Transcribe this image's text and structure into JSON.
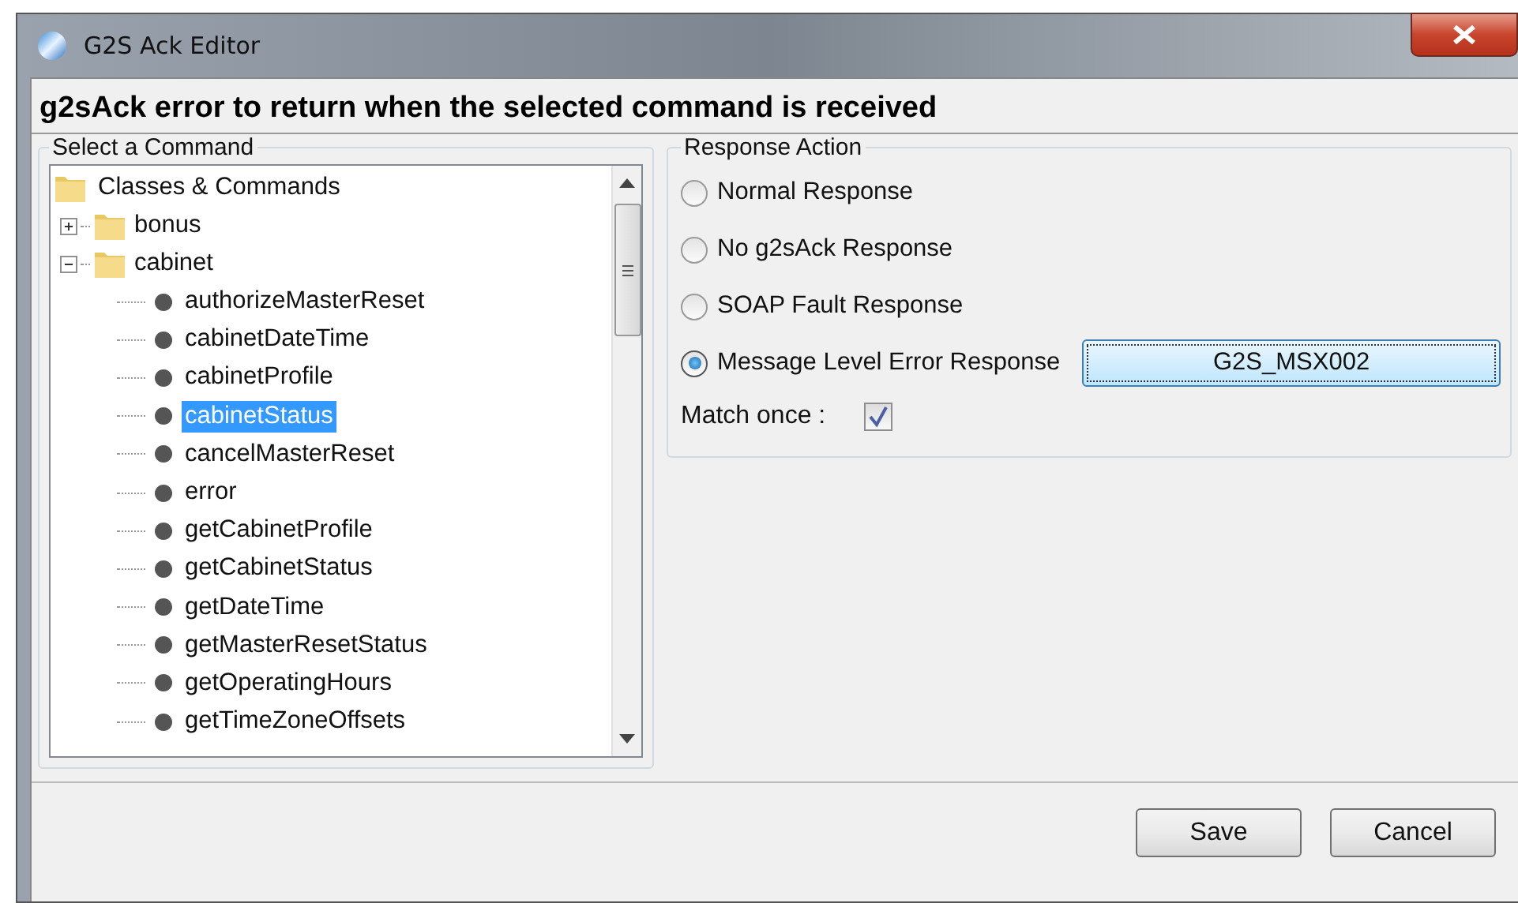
{
  "window": {
    "title": "G2S Ack Editor"
  },
  "heading": "g2sAck error to return when the selected command is received",
  "command_group": {
    "label": "Select a Command",
    "tree": {
      "label": "Classes & Commands",
      "kind": "folder",
      "children": [
        {
          "label": "bonus",
          "kind": "folder",
          "expanded": false
        },
        {
          "label": "cabinet",
          "kind": "folder",
          "expanded": true,
          "children": [
            {
              "label": "authorizeMasterReset",
              "kind": "command",
              "selected": false
            },
            {
              "label": "cabinetDateTime",
              "kind": "command",
              "selected": false
            },
            {
              "label": "cabinetProfile",
              "kind": "command",
              "selected": false
            },
            {
              "label": "cabinetStatus",
              "kind": "command",
              "selected": true
            },
            {
              "label": "cancelMasterReset",
              "kind": "command",
              "selected": false
            },
            {
              "label": "error",
              "kind": "command",
              "selected": false
            },
            {
              "label": "getCabinetProfile",
              "kind": "command",
              "selected": false
            },
            {
              "label": "getCabinetStatus",
              "kind": "command",
              "selected": false
            },
            {
              "label": "getDateTime",
              "kind": "command",
              "selected": false
            },
            {
              "label": "getMasterResetStatus",
              "kind": "command",
              "selected": false
            },
            {
              "label": "getOperatingHours",
              "kind": "command",
              "selected": false
            },
            {
              "label": "getTimeZoneOffsets",
              "kind": "command",
              "selected": false
            }
          ]
        }
      ]
    }
  },
  "response_group": {
    "label": "Response Action",
    "options": [
      {
        "label": "Normal Response",
        "selected": false
      },
      {
        "label": "No g2sAck Response",
        "selected": false
      },
      {
        "label": "SOAP Fault Response",
        "selected": false
      },
      {
        "label": "Message Level Error Response",
        "selected": true
      }
    ],
    "error_code_button": "G2S_MSX002",
    "match_once": {
      "label": "Match once :",
      "checked": true
    }
  },
  "buttons": [
    "Save",
    "Cancel"
  ]
}
